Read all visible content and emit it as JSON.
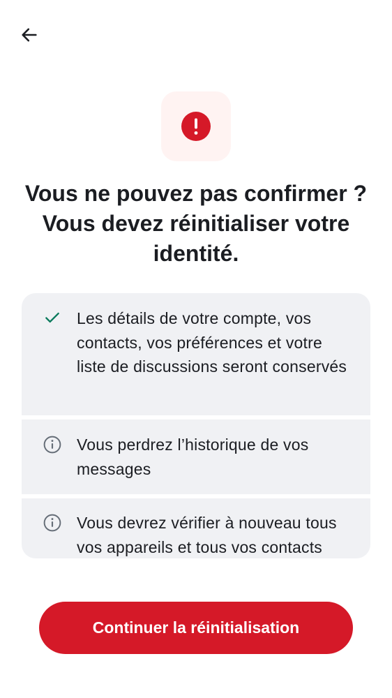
{
  "header": {
    "back_icon": "arrow-left-icon"
  },
  "alert": {
    "icon": "exclamation-circle-icon",
    "color": "#d51928",
    "background": "#fff3f2"
  },
  "title": {
    "line1": "Vous ne pouvez pas confirmer ?",
    "line2": "Vous devez réinitialiser votre",
    "line3": "identité."
  },
  "consequences": [
    {
      "icon": "check-icon",
      "icon_color": "#0a7a5c",
      "text": "Les détails de votre compte, vos contacts, vos préférences et votre liste de discussions seront conservés"
    },
    {
      "icon": "info-icon",
      "icon_color": "#656d77",
      "text": "Vous perdrez l’historique de vos messages"
    },
    {
      "icon": "info-icon",
      "icon_color": "#656d77",
      "text": "Vous devrez vérifier à nouveau tous vos appareils et tous vos contacts"
    }
  ],
  "actions": {
    "continue_label": "Continuer la réinitialisation",
    "continue_color": "#d51928"
  }
}
